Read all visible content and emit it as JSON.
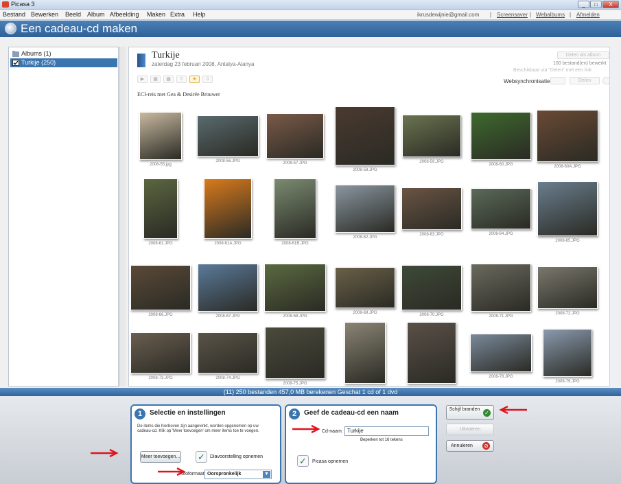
{
  "window": {
    "title": "Picasa 3",
    "btn_min": "_",
    "btn_max": "□",
    "btn_close": "X"
  },
  "menu": {
    "items": [
      "Bestand",
      "Bewerken",
      "Beeld",
      "Album",
      "Afbeelding",
      "Maken",
      "Extra",
      "Help"
    ],
    "right": {
      "email": "ikrusdewijnie@gmail.com",
      "sep": "|",
      "screensaver": "Screensaver",
      "webalbums": "Webalbums",
      "logout": "Afmelden"
    }
  },
  "banner": {
    "title": "Een cadeau-cd maken"
  },
  "sidebar": {
    "albums": "Albums (1)",
    "album_item": "Turkije (250)"
  },
  "album": {
    "title": "Turkije",
    "date": "zaterdag 23 februari 2008, Antalya-Alanya",
    "caption": "ECI-reis met Gea & Desirée Brouwer",
    "share_btn": "Delen als album",
    "count": "100 bestand(en) bewerkt",
    "ghost_note": "Beschikbaar via \"Delen\" met een link",
    "sync_label": "Websynchronisatie",
    "ghost_btn": "Delen"
  },
  "toolbar": {
    "play": "▶",
    "b2": "▦",
    "b3": "▦",
    "b4": "⇧",
    "star": "★",
    "b6": "⇩"
  },
  "photos": [
    {
      "name": "2008-55.jpg",
      "color": "#c8b9a0"
    },
    {
      "name": "2008-56.JPG",
      "color": "#5a6a6e"
    },
    {
      "name": "2008-57.JPG",
      "color": "#7a5a48"
    },
    {
      "name": "2008-58.JPG",
      "color": "#4a3a30"
    },
    {
      "name": "2008-59.JPG",
      "color": "#6a7450"
    },
    {
      "name": "2008-60.JPG",
      "color": "#3e6a2e"
    },
    {
      "name": "2008-60A.JPG",
      "color": "#6a4a34"
    },
    {
      "name": "2008-61.JPG",
      "color": "#5a6640"
    },
    {
      "name": "2008-61A.JPG",
      "color": "#d87a1c"
    },
    {
      "name": "2008-61B.JPG",
      "color": "#7a8a70"
    },
    {
      "name": "2008-62.JPG",
      "color": "#8a96a0"
    },
    {
      "name": "2008-63.JPG",
      "color": "#6a5444"
    },
    {
      "name": "2008-64.JPG",
      "color": "#5a6a58"
    },
    {
      "name": "2008-65.JPG",
      "color": "#6a7e8e"
    },
    {
      "name": "2008-66.JPG",
      "color": "#5a4a38"
    },
    {
      "name": "2008-67.JPG",
      "color": "#5a7a9a"
    },
    {
      "name": "2008-68.JPG",
      "color": "#5a6a40"
    },
    {
      "name": "2008-69.JPG",
      "color": "#6a6048"
    },
    {
      "name": "2008-70.JPG",
      "color": "#3e4a38"
    },
    {
      "name": "2008-71.JPG",
      "color": "#6a6a5e"
    },
    {
      "name": "2008-72.JPG",
      "color": "#7a786c"
    },
    {
      "name": "2008-73.JPG",
      "color": "#6a5e50"
    },
    {
      "name": "2008-74.JPG",
      "color": "#5a5448"
    },
    {
      "name": "2008-75.JPG",
      "color": "#4a4a3c"
    },
    {
      "name": "",
      "color": "#8a8474"
    },
    {
      "name": "",
      "color": "#5a5048"
    },
    {
      "name": "2008-78.JPG",
      "color": "#7a8a9a"
    },
    {
      "name": "2008-79.JPG",
      "color": "#8a9aae"
    }
  ],
  "status": "(11) 250 bestanden 457,0 MB berekenen Geschat 1 cd of 1 dvd",
  "panel1": {
    "num": "1",
    "title": "Selectie en instellingen",
    "desc": "De items die hierboven zijn aangevinkt, worden opgenomen op uw cadeau-cd. Klik op 'Meer toevoegen' om meer items toe te voegen.",
    "add_btn": "Meer toevoegen...",
    "slideshow": "Diavoorstelling opnemen",
    "format_label": "Fotoformaat",
    "format_value": "Oorspronkelijk"
  },
  "panel2": {
    "num": "2",
    "title": "Geef de cadeau-cd een naam",
    "cd_label": "Cd-naam:",
    "cd_value": "Turkije",
    "limit": "Beperken tot 16 tekens",
    "picasa": "Picasa opnemen"
  },
  "actions": {
    "burn": "Schijf branden",
    "create": "Uitvoeren",
    "cancel": "Annuleren"
  },
  "colors": {
    "accent": "#3a75b0",
    "arrow": "#e0141e"
  }
}
